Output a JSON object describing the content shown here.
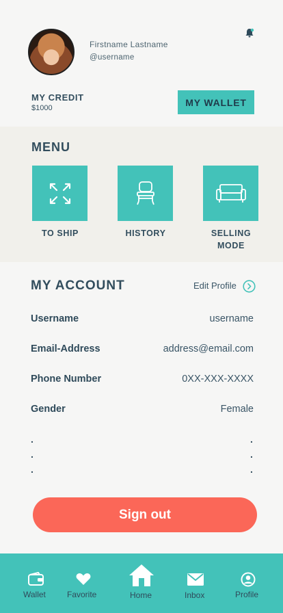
{
  "profile": {
    "name": "Firstname Lastname",
    "username": "@username"
  },
  "credit": {
    "label": "MY CREDIT",
    "value": "$1000",
    "wallet_button": "MY WALLET"
  },
  "menu": {
    "title": "MENU",
    "items": [
      {
        "label": "TO SHIP",
        "icon": "expand-arrows-icon"
      },
      {
        "label": "HISTORY",
        "icon": "chair-icon"
      },
      {
        "label": "SELLING\nMODE",
        "icon": "sofa-icon"
      }
    ]
  },
  "account": {
    "title": "MY ACCOUNT",
    "edit_label": "Edit Profile",
    "rows": [
      {
        "label": "Username",
        "value": "username"
      },
      {
        "label": "Email-Address",
        "value": "address@email.com"
      },
      {
        "label": "Phone Number",
        "value": "0XX-XXX-XXXX"
      },
      {
        "label": "Gender",
        "value": "Female"
      }
    ],
    "ellipsis": "."
  },
  "signout_label": "Sign out",
  "nav": {
    "items": [
      {
        "label": "Wallet",
        "icon": "wallet-icon"
      },
      {
        "label": "Favorite",
        "icon": "heart-icon"
      },
      {
        "label": "Home",
        "icon": "home-icon"
      },
      {
        "label": "Inbox",
        "icon": "envelope-icon"
      },
      {
        "label": "Profile",
        "icon": "profile-icon"
      }
    ]
  },
  "colors": {
    "accent": "#43c2b9",
    "signout": "#fb6758",
    "text": "#324d5d",
    "menu_band": "#f1f0eb"
  }
}
